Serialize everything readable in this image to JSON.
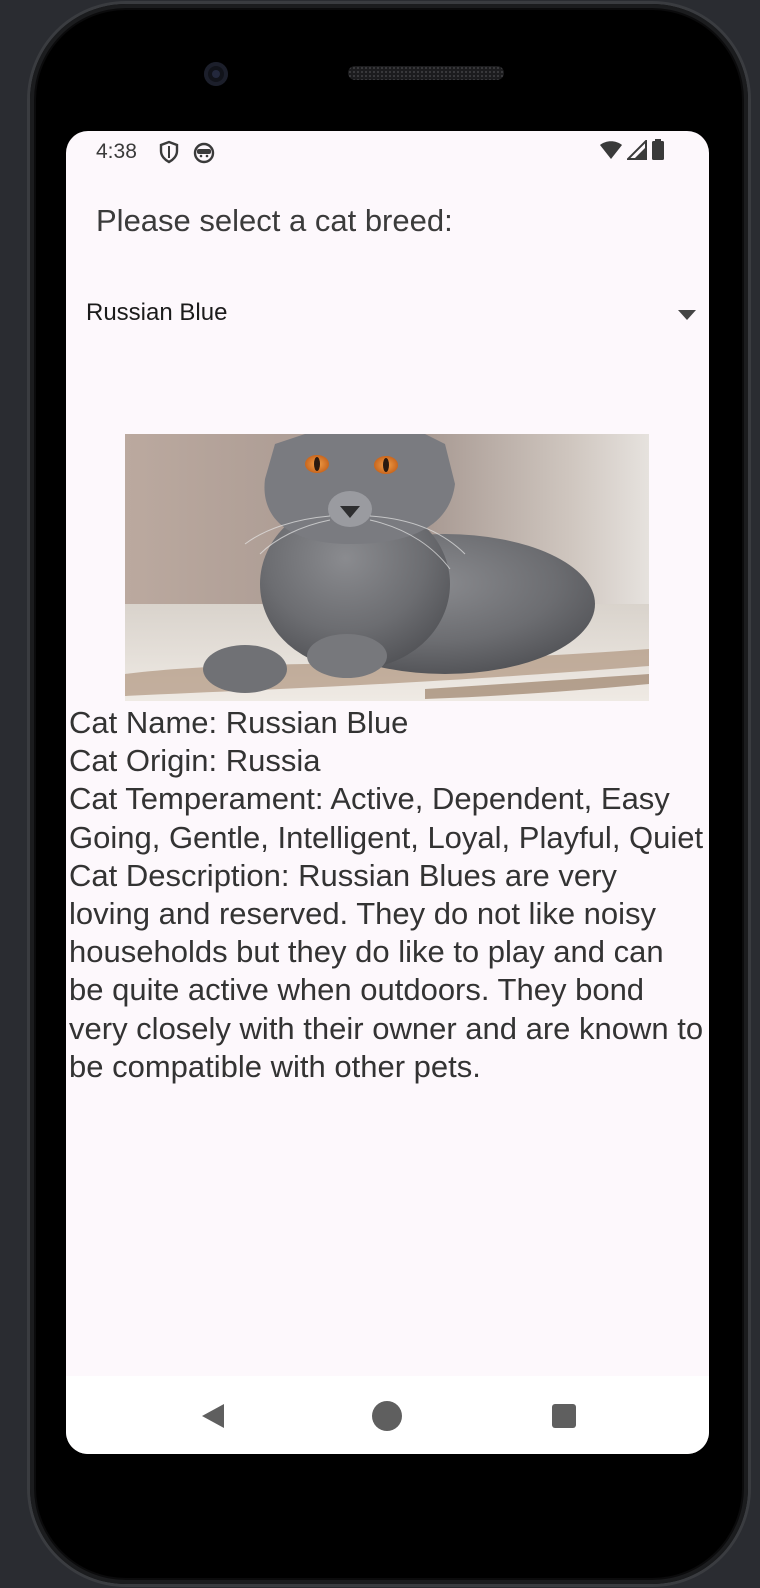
{
  "status_bar": {
    "time": "4:38",
    "left_icons": [
      "shield-icon",
      "android-face-icon"
    ],
    "right_icons": [
      "wifi-icon",
      "cell-signal-icon",
      "battery-icon"
    ]
  },
  "main": {
    "prompt": "Please select a cat breed:",
    "breed_select": {
      "selected_value": "Russian Blue",
      "icon": "dropdown-arrow-icon"
    },
    "cat_image": {
      "alt": "Russian Blue cat photo"
    },
    "info": {
      "name_line": "Cat Name: Russian Blue",
      "origin_line": "Cat Origin: Russia",
      "temperament_line": "Cat Temperament: Active, Dependent, Easy Going, Gentle, Intelligent, Loyal, Playful, Quiet",
      "description_line": "Cat Description: Russian Blues are very loving and reserved. They do not like noisy households but they do like to play and can be quite active when outdoors. They bond very closely with their owner and are known to be compatible with other pets."
    }
  },
  "nav_bar": {
    "buttons": [
      "back-icon",
      "home-icon",
      "recents-icon"
    ]
  },
  "colors": {
    "screen_background": "#fdf8fc",
    "text_primary": "#333333",
    "nav_icon": "#5f5f5f"
  }
}
